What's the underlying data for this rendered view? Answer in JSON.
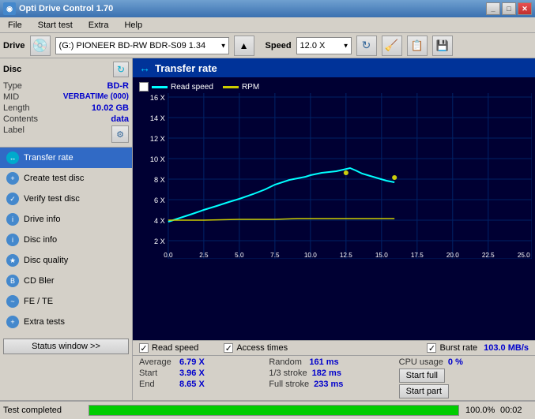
{
  "titleBar": {
    "title": "Opti Drive Control 1.70",
    "buttons": [
      "_",
      "□",
      "✕"
    ]
  },
  "menuBar": {
    "items": [
      "File",
      "Start test",
      "Extra",
      "Help"
    ]
  },
  "driveBar": {
    "driveLabel": "Drive",
    "driveValue": "(G:)  PIONEER BD-RW  BDR-S09 1.34",
    "speedLabel": "Speed",
    "speedValue": "12.0 X"
  },
  "disc": {
    "title": "Disc",
    "type": {
      "key": "Type",
      "val": "BD-R"
    },
    "mid": {
      "key": "MID",
      "val": "VERBATIMe (000)"
    },
    "length": {
      "key": "Length",
      "val": "10.02 GB"
    },
    "contents": {
      "key": "Contents",
      "val": "data"
    },
    "label": {
      "key": "Label",
      "val": ""
    }
  },
  "nav": {
    "items": [
      {
        "id": "transfer-rate",
        "label": "Transfer rate",
        "active": true
      },
      {
        "id": "create-test-disc",
        "label": "Create test disc",
        "active": false
      },
      {
        "id": "verify-test-disc",
        "label": "Verify test disc",
        "active": false
      },
      {
        "id": "drive-info",
        "label": "Drive info",
        "active": false
      },
      {
        "id": "disc-info",
        "label": "Disc info",
        "active": false
      },
      {
        "id": "disc-quality",
        "label": "Disc quality",
        "active": false
      },
      {
        "id": "cd-bler",
        "label": "CD Bler",
        "active": false
      },
      {
        "id": "fe-te",
        "label": "FE / TE",
        "active": false
      },
      {
        "id": "extra-tests",
        "label": "Extra tests",
        "active": false
      }
    ]
  },
  "chart": {
    "title": "Transfer rate",
    "legend": {
      "readSpeed": "Read speed",
      "rpm": "RPM"
    },
    "yAxisLabels": [
      "16 X",
      "14 X",
      "12 X",
      "10 X",
      "8 X",
      "6 X",
      "4 X",
      "2 X"
    ],
    "xAxisLabels": [
      "0.0",
      "2.5",
      "5.0",
      "7.5",
      "10.0",
      "12.5",
      "15.0",
      "17.5",
      "20.0",
      "22.5",
      "25.0"
    ]
  },
  "statsBar": {
    "readSpeed": "Read speed",
    "accessTimes": "Access times",
    "burstRate": "Burst rate",
    "burstVal": "103.0 MB/s"
  },
  "metrics": {
    "average": {
      "key": "Average",
      "val": "6.79 X"
    },
    "start": {
      "key": "Start",
      "val": "3.96 X"
    },
    "end": {
      "key": "End",
      "val": "8.65 X"
    },
    "random": {
      "key": "Random",
      "val": "161 ms"
    },
    "stroke1_3": {
      "key": "1/3 stroke",
      "val": "182 ms"
    },
    "fullStroke": {
      "key": "Full stroke",
      "val": "233 ms"
    },
    "cpuUsage": {
      "key": "CPU usage",
      "val": "0 %"
    },
    "startFull": "Start full",
    "startPart": "Start part"
  },
  "statusBar": {
    "text": "Test completed",
    "progress": 100,
    "progressPct": "100.0%",
    "time": "00:02",
    "windowBtn": "Status window >>"
  }
}
